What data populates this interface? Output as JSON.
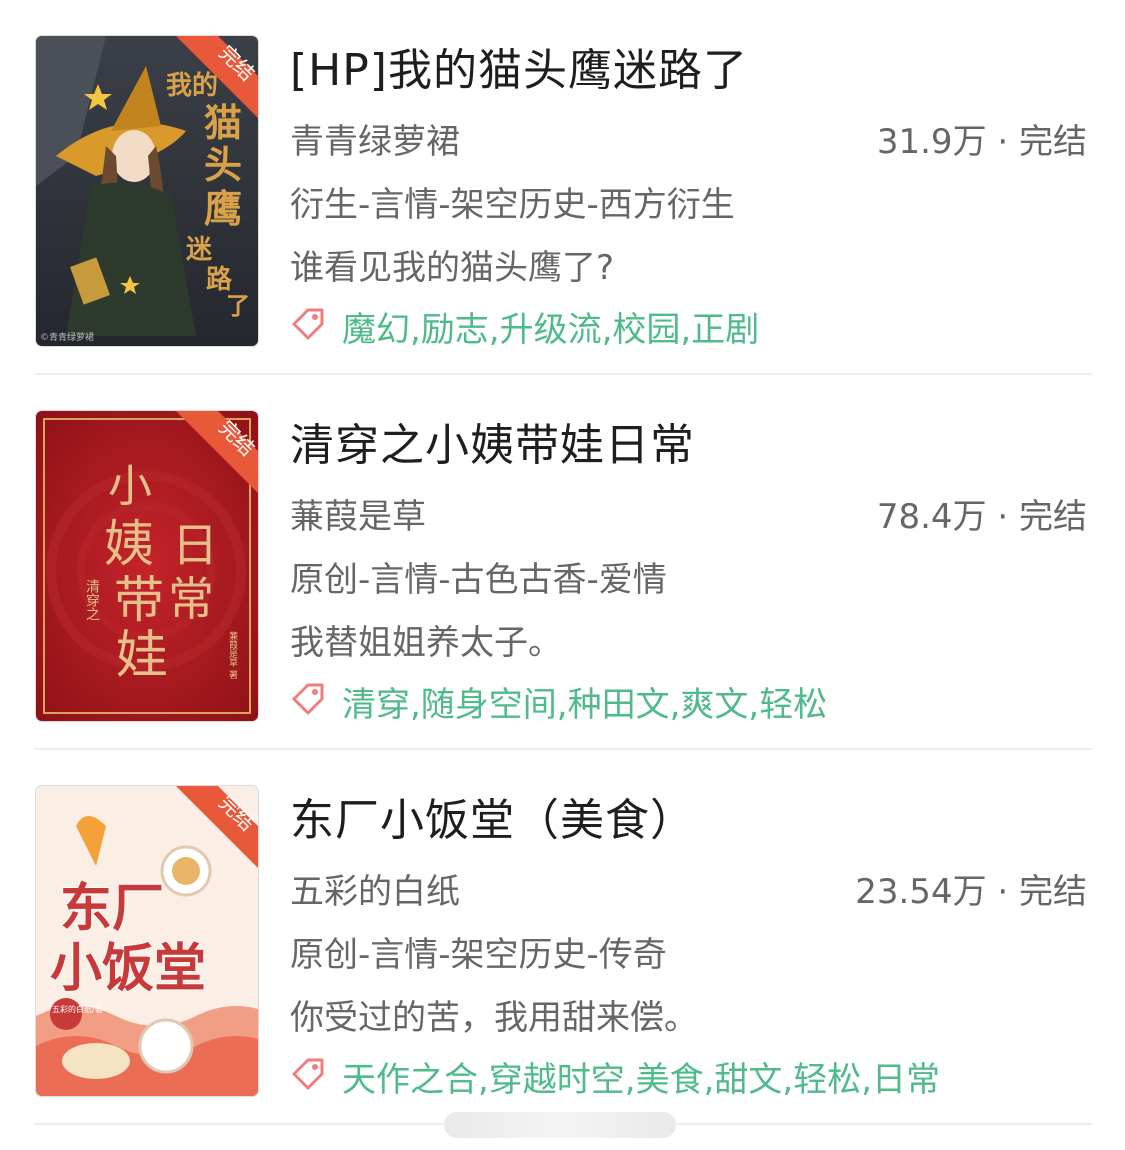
{
  "colors": {
    "accent_green": "#4fba8a",
    "ribbon": "#e8593a",
    "tag_icon": "#f07c7c"
  },
  "books": [
    {
      "title": "[HP]我的猫头鹰迷路了",
      "author": "青青绿萝裙",
      "meta": "31.9万 · 完结",
      "category": "衍生-言情-架空历史-西方衍生",
      "summary": "谁看见我的猫头鹰了?",
      "tags": "魔幻,励志,升级流,校园,正剧",
      "cover": {
        "ribbon": "完结",
        "title_chars": [
          "我的",
          "猫",
          "头",
          "鹰",
          "迷",
          "路",
          "了"
        ],
        "author_mark": "©青青绿萝裙"
      }
    },
    {
      "title": "清穿之小姨带娃日常",
      "author": "蒹葭是草",
      "meta": "78.4万 · 完结",
      "category": "原创-言情-古色古香-爱情",
      "summary": "我替姐姐养太子。",
      "tags": "清穿,随身空间,种田文,爽文,轻松",
      "cover": {
        "ribbon": "完结",
        "title_main": [
          "小",
          "姨",
          "带",
          "娃"
        ],
        "title_side": [
          "日",
          "常"
        ],
        "subtitle": "清穿之",
        "author_mark": "蒹葭是草 著"
      }
    },
    {
      "title": "东厂小饭堂（美食）",
      "author": "五彩的白纸",
      "meta": "23.54万 · 完结",
      "category": "原创-言情-架空历史-传奇",
      "summary": "你受过的苦，我用甜来偿。",
      "tags": "天作之合,穿越时空,美食,甜文,轻松,日常",
      "cover": {
        "ribbon": "完结",
        "title_line1": "东厂",
        "title_line2": "小饭堂",
        "author_mark": "五彩的白纸/著"
      }
    }
  ]
}
